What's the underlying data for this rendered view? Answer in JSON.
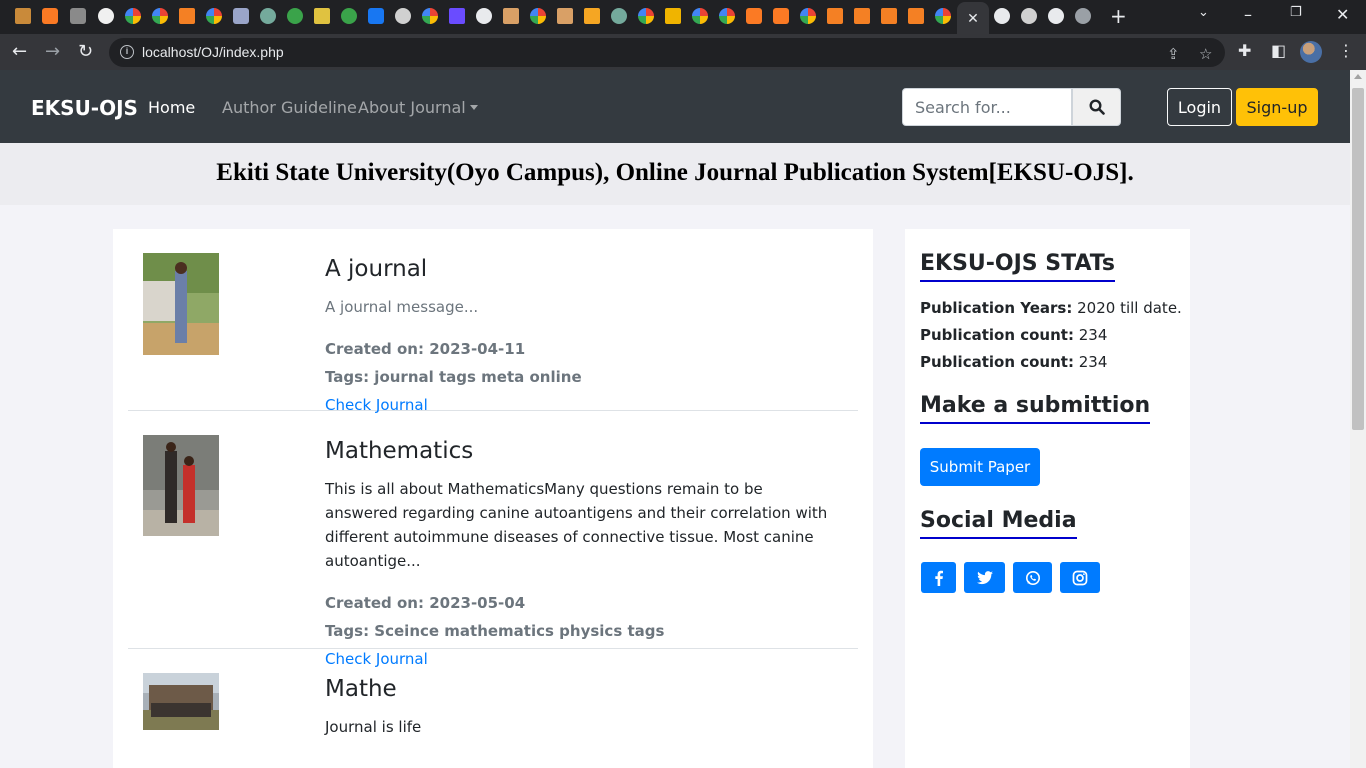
{
  "browser": {
    "url": "localhost/OJ/index.php",
    "new_tab_label": "+"
  },
  "navbar": {
    "brand": "EKSU-OJS",
    "links": [
      "Home",
      "Author Guideline",
      "About Journal"
    ],
    "search_placeholder": "Search for...",
    "login_label": "Login",
    "signup_label": "Sign-up"
  },
  "banner": {
    "title": "Ekiti State University(Oyo Campus), Online Journal Publication System[EKSU-OJS]."
  },
  "journals": [
    {
      "title": "A journal",
      "message": "A journal message...",
      "created": "Created on: 2023-04-11",
      "tags": "Tags: journal tags meta online",
      "link": "Check Journal"
    },
    {
      "title": "Mathematics",
      "message": "This is all about MathematicsMany questions remain to be answered regarding canine autoantigens and their correlation with different autoimmune diseases of connective tissue. Most canine autoantige...",
      "created": "Created on: 2023-05-04",
      "tags": "Tags: Sceince mathematics physics tags",
      "link": "Check Journal"
    },
    {
      "title": "Mathe",
      "message": "Journal is life"
    }
  ],
  "sidebar": {
    "stats_heading": "EKSU-OJS STATs",
    "stats": [
      {
        "label": "Publication Years:",
        "value": "2020 till date."
      },
      {
        "label": "Publication count:",
        "value": "234"
      },
      {
        "label": "Publication count:",
        "value": "234"
      }
    ],
    "submit_heading": "Make a submittion",
    "submit_label": "Submit Paper",
    "social_heading": "Social Media",
    "social_icons": [
      "facebook-icon",
      "twitter-icon",
      "whatsapp-icon",
      "instagram-icon"
    ]
  },
  "colors": {
    "navbar_bg": "#343a40",
    "accent": "#007bff",
    "signup": "#ffc107",
    "heading_underline": "#0000cc"
  }
}
